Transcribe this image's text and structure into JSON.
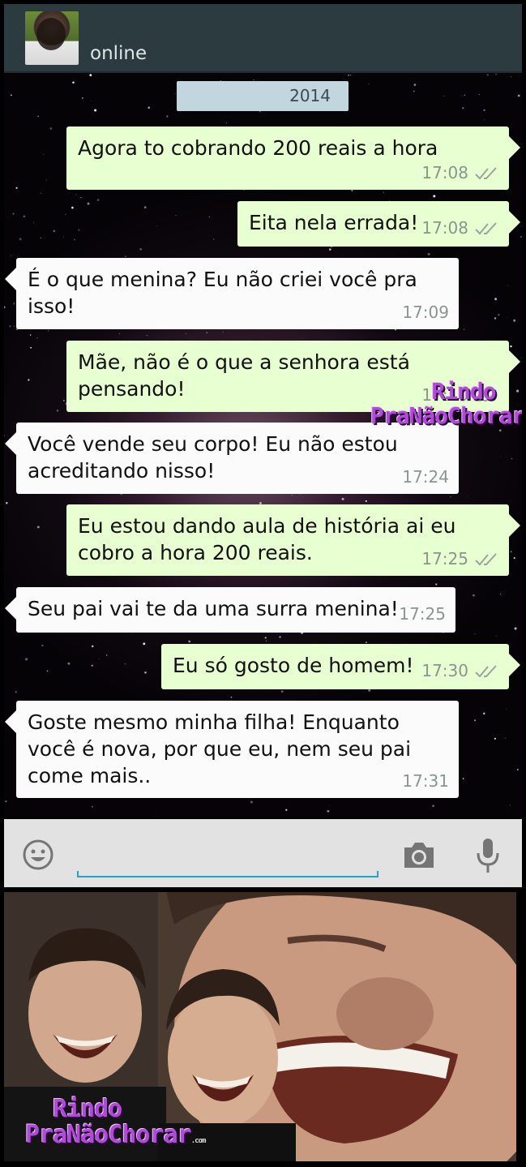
{
  "header": {
    "status": "online"
  },
  "date_chip": "2014",
  "messages": [
    {
      "dir": "out",
      "text": "Agora to cobrando 200 reais a hora",
      "time": "17:08",
      "ticks": true
    },
    {
      "dir": "out",
      "text": "Eita nela errada!",
      "time": "17:08",
      "ticks": true
    },
    {
      "dir": "in",
      "text": "É o que menina? Eu não criei você pra isso!",
      "time": "17:09"
    },
    {
      "dir": "out",
      "text": "Mãe, não é o que a senhora está pensando!",
      "time": "17:10",
      "ticks": true
    },
    {
      "dir": "in",
      "text": "Você vende seu corpo! Eu não estou acreditando nisso!",
      "time": "17:24"
    },
    {
      "dir": "out",
      "text": "Eu estou dando aula de história ai eu cobro a hora 200 reais.",
      "time": "17:25",
      "ticks": true
    },
    {
      "dir": "in",
      "text": "Seu pai vai te da uma surra menina!",
      "time": "17:25"
    },
    {
      "dir": "out",
      "text": "Eu só gosto de homem!",
      "time": "17:30",
      "ticks": true
    },
    {
      "dir": "in",
      "text": "Goste mesmo minha filha! Enquanto você é nova, por que eu, nem seu pai come mais..",
      "time": "17:31"
    }
  ],
  "watermark": {
    "line1": "Rindo",
    "line2": "PraNãoChorar",
    "suffix": ".com"
  },
  "colors": {
    "header_bg": "#2b3b3f",
    "out_bubble": "#e8ffd1",
    "in_bubble": "#fbfbfb",
    "input_accent": "#27a1d2",
    "watermark": "#b24ad8"
  },
  "icons": {
    "emoji": "emoji-icon",
    "camera": "camera-icon",
    "mic": "mic-icon",
    "ticks": "double-check-icon"
  }
}
